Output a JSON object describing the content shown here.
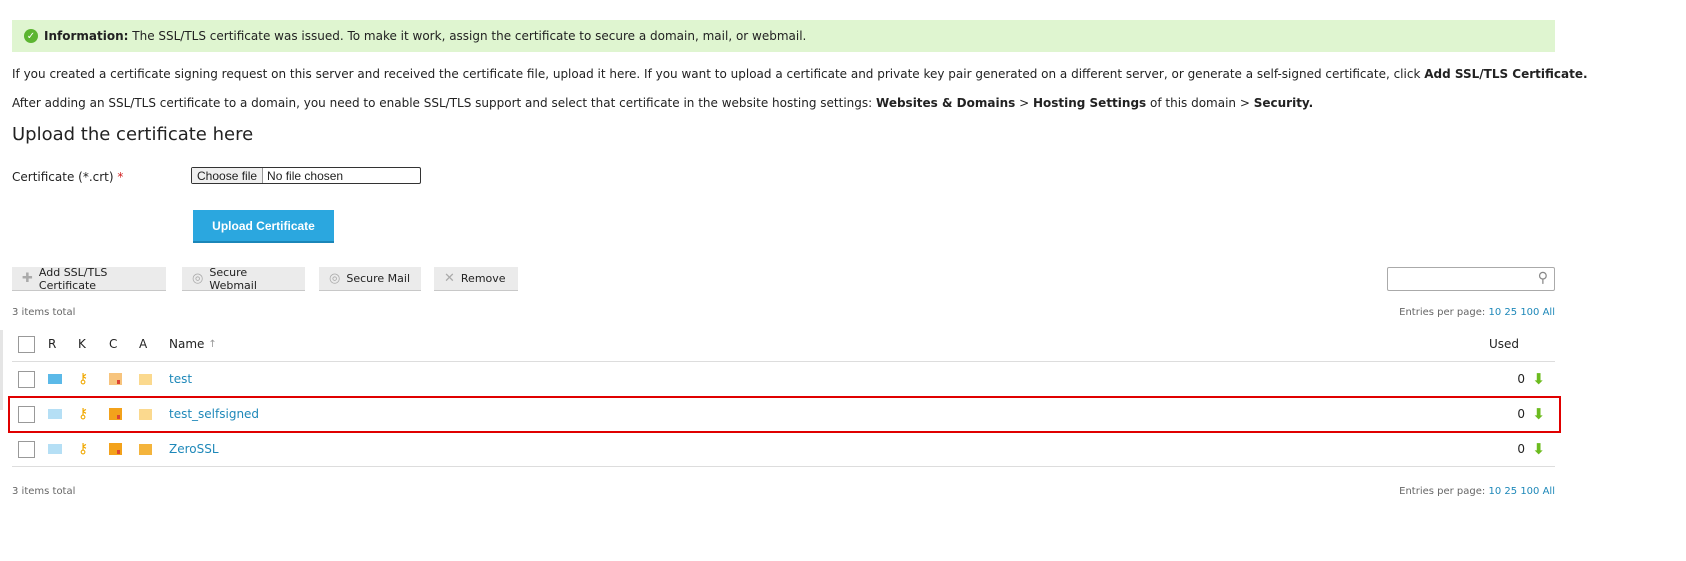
{
  "info": {
    "label": "Information:",
    "text": " The SSL/TLS certificate was issued. To make it work, assign the certificate to secure a domain, mail, or webmail."
  },
  "para1": {
    "text": "If you created a certificate signing request on this server and received the certificate file, upload it here. If you want to upload a certificate and private key pair generated on a different server, or generate a self-signed certificate, click ",
    "bold": "Add SSL/TLS Certificate."
  },
  "para2": {
    "text": "After adding an SSL/TLS certificate to a domain, you need to enable SSL/TLS support and select that certificate in the website hosting settings: ",
    "b1": "Websites & Domains",
    "sep": " > ",
    "b2": "Hosting Settings",
    "mid": " of this domain > ",
    "b3": "Security."
  },
  "heading": "Upload the certificate here",
  "form": {
    "label": "Certificate (*.crt)",
    "required": "*",
    "choose": "Choose file",
    "no_file": "No file chosen",
    "upload": "Upload Certificate"
  },
  "toolbar": {
    "add": "Add SSL/TLS Certificate",
    "webmail": "Secure Webmail",
    "mail": "Secure Mail",
    "remove": "Remove"
  },
  "list": {
    "total": "3 items total",
    "entries_label": "Entries per page:",
    "entries": [
      "10",
      "25",
      "100",
      "All"
    ],
    "headers": {
      "r": "R",
      "k": "K",
      "c": "C",
      "a": "A",
      "name": "Name",
      "sort": "↑",
      "used": "Used"
    },
    "rows": [
      {
        "name": "test",
        "used": "0"
      },
      {
        "name": "test_selfsigned",
        "used": "0"
      },
      {
        "name": "ZeroSSL",
        "used": "0"
      }
    ]
  }
}
